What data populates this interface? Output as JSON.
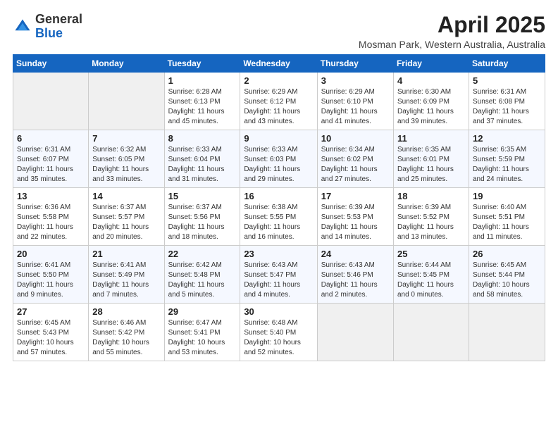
{
  "header": {
    "logo_general": "General",
    "logo_blue": "Blue",
    "month_title": "April 2025",
    "location": "Mosman Park, Western Australia, Australia"
  },
  "weekdays": [
    "Sunday",
    "Monday",
    "Tuesday",
    "Wednesday",
    "Thursday",
    "Friday",
    "Saturday"
  ],
  "weeks": [
    [
      {
        "day": "",
        "info": ""
      },
      {
        "day": "",
        "info": ""
      },
      {
        "day": "1",
        "info": "Sunrise: 6:28 AM\nSunset: 6:13 PM\nDaylight: 11 hours and 45 minutes."
      },
      {
        "day": "2",
        "info": "Sunrise: 6:29 AM\nSunset: 6:12 PM\nDaylight: 11 hours and 43 minutes."
      },
      {
        "day": "3",
        "info": "Sunrise: 6:29 AM\nSunset: 6:10 PM\nDaylight: 11 hours and 41 minutes."
      },
      {
        "day": "4",
        "info": "Sunrise: 6:30 AM\nSunset: 6:09 PM\nDaylight: 11 hours and 39 minutes."
      },
      {
        "day": "5",
        "info": "Sunrise: 6:31 AM\nSunset: 6:08 PM\nDaylight: 11 hours and 37 minutes."
      }
    ],
    [
      {
        "day": "6",
        "info": "Sunrise: 6:31 AM\nSunset: 6:07 PM\nDaylight: 11 hours and 35 minutes."
      },
      {
        "day": "7",
        "info": "Sunrise: 6:32 AM\nSunset: 6:05 PM\nDaylight: 11 hours and 33 minutes."
      },
      {
        "day": "8",
        "info": "Sunrise: 6:33 AM\nSunset: 6:04 PM\nDaylight: 11 hours and 31 minutes."
      },
      {
        "day": "9",
        "info": "Sunrise: 6:33 AM\nSunset: 6:03 PM\nDaylight: 11 hours and 29 minutes."
      },
      {
        "day": "10",
        "info": "Sunrise: 6:34 AM\nSunset: 6:02 PM\nDaylight: 11 hours and 27 minutes."
      },
      {
        "day": "11",
        "info": "Sunrise: 6:35 AM\nSunset: 6:01 PM\nDaylight: 11 hours and 25 minutes."
      },
      {
        "day": "12",
        "info": "Sunrise: 6:35 AM\nSunset: 5:59 PM\nDaylight: 11 hours and 24 minutes."
      }
    ],
    [
      {
        "day": "13",
        "info": "Sunrise: 6:36 AM\nSunset: 5:58 PM\nDaylight: 11 hours and 22 minutes."
      },
      {
        "day": "14",
        "info": "Sunrise: 6:37 AM\nSunset: 5:57 PM\nDaylight: 11 hours and 20 minutes."
      },
      {
        "day": "15",
        "info": "Sunrise: 6:37 AM\nSunset: 5:56 PM\nDaylight: 11 hours and 18 minutes."
      },
      {
        "day": "16",
        "info": "Sunrise: 6:38 AM\nSunset: 5:55 PM\nDaylight: 11 hours and 16 minutes."
      },
      {
        "day": "17",
        "info": "Sunrise: 6:39 AM\nSunset: 5:53 PM\nDaylight: 11 hours and 14 minutes."
      },
      {
        "day": "18",
        "info": "Sunrise: 6:39 AM\nSunset: 5:52 PM\nDaylight: 11 hours and 13 minutes."
      },
      {
        "day": "19",
        "info": "Sunrise: 6:40 AM\nSunset: 5:51 PM\nDaylight: 11 hours and 11 minutes."
      }
    ],
    [
      {
        "day": "20",
        "info": "Sunrise: 6:41 AM\nSunset: 5:50 PM\nDaylight: 11 hours and 9 minutes."
      },
      {
        "day": "21",
        "info": "Sunrise: 6:41 AM\nSunset: 5:49 PM\nDaylight: 11 hours and 7 minutes."
      },
      {
        "day": "22",
        "info": "Sunrise: 6:42 AM\nSunset: 5:48 PM\nDaylight: 11 hours and 5 minutes."
      },
      {
        "day": "23",
        "info": "Sunrise: 6:43 AM\nSunset: 5:47 PM\nDaylight: 11 hours and 4 minutes."
      },
      {
        "day": "24",
        "info": "Sunrise: 6:43 AM\nSunset: 5:46 PM\nDaylight: 11 hours and 2 minutes."
      },
      {
        "day": "25",
        "info": "Sunrise: 6:44 AM\nSunset: 5:45 PM\nDaylight: 11 hours and 0 minutes."
      },
      {
        "day": "26",
        "info": "Sunrise: 6:45 AM\nSunset: 5:44 PM\nDaylight: 10 hours and 58 minutes."
      }
    ],
    [
      {
        "day": "27",
        "info": "Sunrise: 6:45 AM\nSunset: 5:43 PM\nDaylight: 10 hours and 57 minutes."
      },
      {
        "day": "28",
        "info": "Sunrise: 6:46 AM\nSunset: 5:42 PM\nDaylight: 10 hours and 55 minutes."
      },
      {
        "day": "29",
        "info": "Sunrise: 6:47 AM\nSunset: 5:41 PM\nDaylight: 10 hours and 53 minutes."
      },
      {
        "day": "30",
        "info": "Sunrise: 6:48 AM\nSunset: 5:40 PM\nDaylight: 10 hours and 52 minutes."
      },
      {
        "day": "",
        "info": ""
      },
      {
        "day": "",
        "info": ""
      },
      {
        "day": "",
        "info": ""
      }
    ]
  ]
}
